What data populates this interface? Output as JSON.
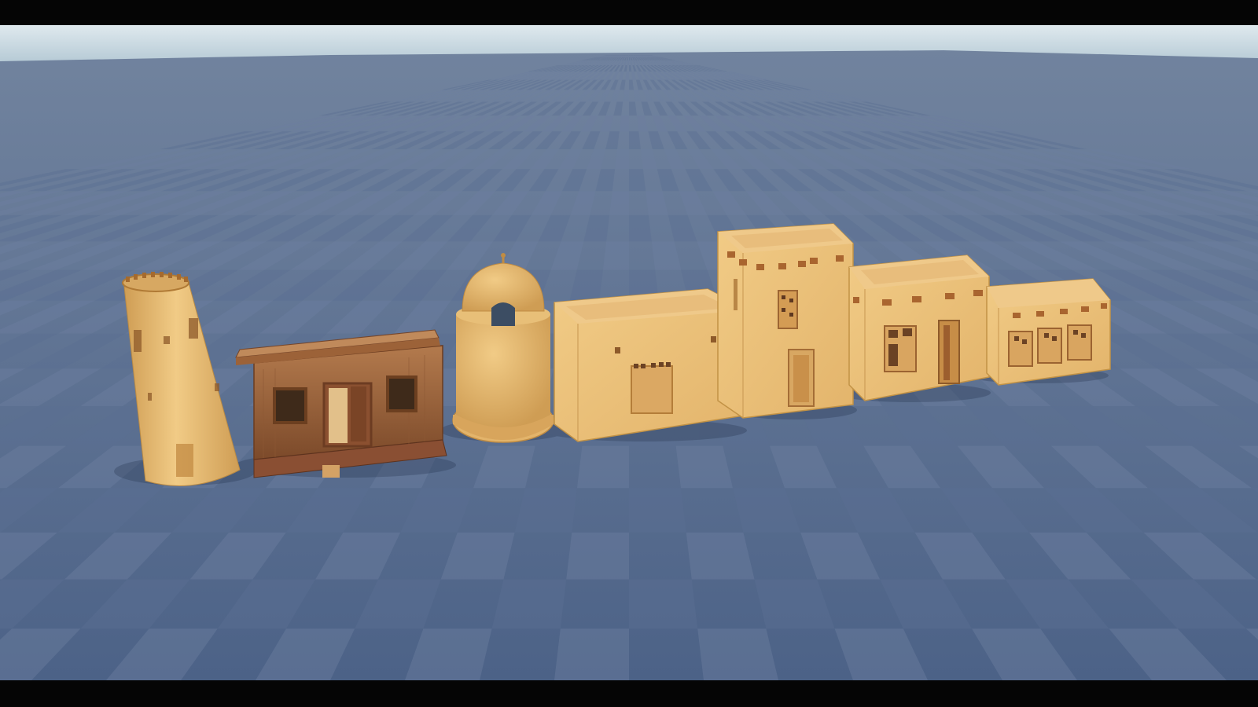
{
  "scene": {
    "letterbox_color": "#050505",
    "sky_top_color": "#dfe9ee",
    "sky_bottom_color": "#b7cbd6",
    "ground_far_color": "#71839e",
    "ground_near_color": "#4c6287",
    "grid_light_color": "#6d7fa0",
    "grid_dark_color": "#5a6f92",
    "mud_light_color": "#f1cb86",
    "mud_mid_color": "#e3b46b",
    "mud_dark_color": "#cf9d54",
    "wood_light_color": "#b37a4d",
    "wood_dark_color": "#7c4a2a",
    "beam_color": "#9a5d32",
    "buildings": [
      {
        "name": "tapered-watchtower-model",
        "kind": "tower"
      },
      {
        "name": "wooden-hut-model",
        "kind": "wood-house"
      },
      {
        "name": "domed-kiosk-model",
        "kind": "dome"
      },
      {
        "name": "flat-roof-house-model",
        "kind": "house"
      },
      {
        "name": "two-storey-mud-house-model",
        "kind": "tall-house"
      },
      {
        "name": "beamed-mud-house-model",
        "kind": "house"
      },
      {
        "name": "low-mud-house-model",
        "kind": "house"
      }
    ]
  }
}
